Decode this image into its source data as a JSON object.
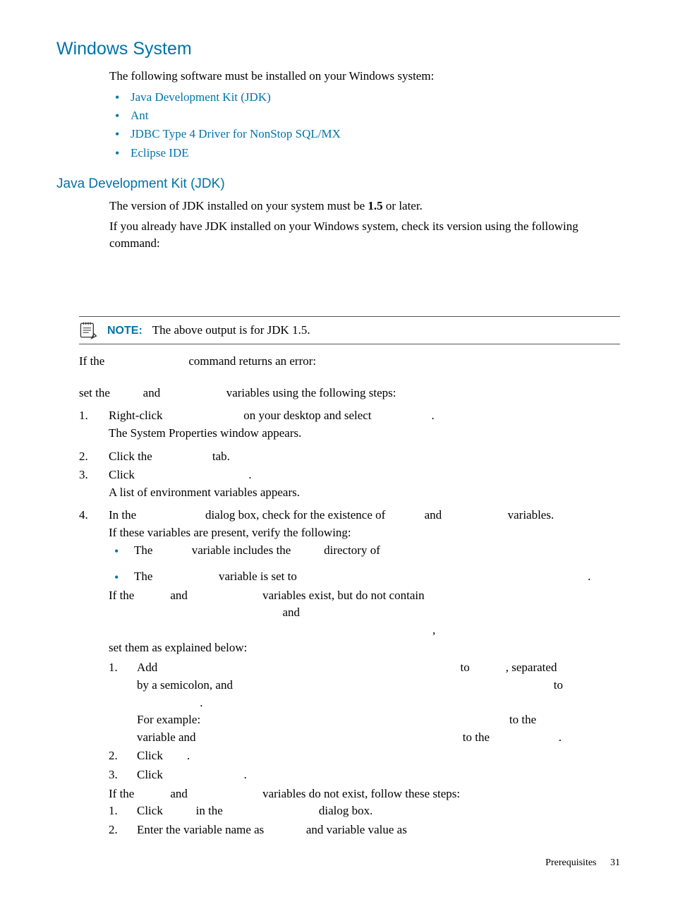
{
  "h1": "Windows System",
  "intro": "The following software must be installed on your Windows system:",
  "softwareList": [
    "Java Development Kit (JDK)",
    "Ant",
    "JDBC Type 4 Driver for NonStop SQL/MX",
    "Eclipse IDE"
  ],
  "h2": "Java Development Kit (JDK)",
  "jdk_p1_a": "The version of JDK installed on your system must be ",
  "jdk_p1_b": "1.5",
  "jdk_p1_c": " or later.",
  "jdk_p2": "If you already have JDK installed on your Windows system, check its version using the following command:",
  "note_label": "NOTE:",
  "note_text": "The above output is for JDK 1.5.",
  "ifthe_a": "If the",
  "ifthe_b": " command returns an error:",
  "setthe_a": "set the ",
  "setthe_b": " and ",
  "setthe_c": " variables using the following steps:",
  "s1_a": "Right-click ",
  "s1_b": " on your desktop and select ",
  "s1_c": ".",
  "s1_follow": "The System Properties window appears.",
  "s2_a": "Click the ",
  "s2_b": " tab.",
  "s3_a": "Click ",
  "s3_b": ".",
  "s3_follow": "A list of environment variables appears.",
  "s4_a": "In the ",
  "s4_b": " dialog box, check for the existence of ",
  "s4_c": " and ",
  "s4_d": " variables.",
  "s4_follow": "If these variables are present, verify the following:",
  "s4_i1_a": "The ",
  "s4_i1_b": " variable includes the ",
  "s4_i1_c": " directory of",
  "s4_i2_a": "The ",
  "s4_i2_b": " variable is set to ",
  "s4_i2_c": ".",
  "s4_if_a": "If the ",
  "s4_if_b": " and ",
  "s4_if_c": " variables exist, but do not contain",
  "s4_if_d": " and ",
  "s4_if_e": ",",
  "s4_set": "set them as explained below:",
  "s4_s1_a": "Add ",
  "s4_s1_b": " to ",
  "s4_s1_c": ", separated",
  "s4_s1_d": "by a semicolon, and ",
  "s4_s1_e": " to",
  "s4_s1_f": ".",
  "s4_s1_g": "For example: ",
  "s4_s1_h": " to the ",
  "s4_s1_i": "variable and ",
  "s4_s1_j": " to the ",
  "s4_s1_k": ".",
  "s4_s2_a": "Click ",
  "s4_s2_b": ".",
  "s4_s3_a": "Click ",
  "s4_s3_b": ".",
  "s4_if2_a": "If the ",
  "s4_if2_b": " and ",
  "s4_if2_c": " variables do not exist, follow these steps:",
  "s4_n1_a": "Click ",
  "s4_n1_b": " in the ",
  "s4_n1_c": " dialog box.",
  "s4_n2_a": "Enter the variable name as ",
  "s4_n2_b": " and variable value as",
  "footer_label": "Prerequisites",
  "footer_page": "31"
}
